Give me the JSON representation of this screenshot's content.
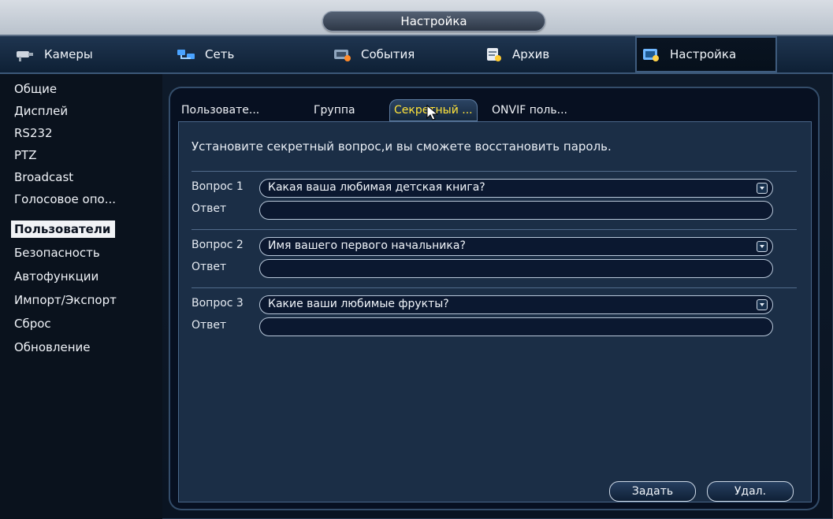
{
  "window": {
    "title": "Настройка"
  },
  "top_tabs": [
    {
      "label": "Камеры",
      "icon": "camera-icon"
    },
    {
      "label": "Сеть",
      "icon": "network-icon"
    },
    {
      "label": "События",
      "icon": "events-icon"
    },
    {
      "label": "Архив",
      "icon": "archive-icon"
    },
    {
      "label": "Настройка",
      "icon": "settings-icon",
      "active": true
    }
  ],
  "sidebar": {
    "items": [
      {
        "label": "Общие"
      },
      {
        "label": "Дисплей"
      },
      {
        "label": "RS232"
      },
      {
        "label": "PTZ"
      },
      {
        "label": "Broadcast"
      },
      {
        "label": "Голосовое опо..."
      },
      {
        "label": "Пользователи",
        "active": true
      },
      {
        "label": "Безопасность"
      },
      {
        "label": "Автофункции"
      },
      {
        "label": "Импорт/Экспорт"
      },
      {
        "label": "Сброс"
      },
      {
        "label": "Обновление"
      }
    ]
  },
  "subtabs": [
    {
      "label": "Пользовате..."
    },
    {
      "label": "Группа"
    },
    {
      "label": "Секретный ...",
      "active": true
    },
    {
      "label": "ONVIF поль..."
    }
  ],
  "content": {
    "hint": "Установите секретный вопрос,и вы сможете восстановить пароль.",
    "questions": [
      {
        "label": "Вопрос 1",
        "value": "Какая ваша любимая детская книга?",
        "answer_label": "Ответ",
        "answer_value": ""
      },
      {
        "label": "Вопрос 2",
        "value": "Имя вашего первого начальника?",
        "answer_label": "Ответ",
        "answer_value": ""
      },
      {
        "label": "Вопрос 3",
        "value": "Какие ваши любимые фрукты?",
        "answer_label": "Ответ",
        "answer_value": ""
      }
    ],
    "buttons": {
      "set": "Задать",
      "delete": "Удал."
    }
  },
  "colors": {
    "active_subtab_text": "#ffe33a",
    "panel_bg": "#1b2e46"
  }
}
